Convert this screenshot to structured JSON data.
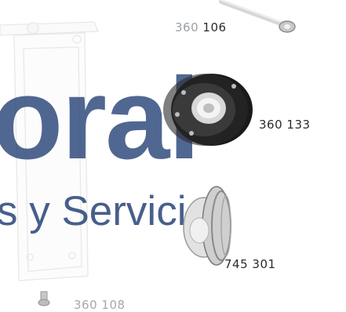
{
  "watermark": {
    "wordmark": "oral",
    "tagline": "s y Servicios"
  },
  "parts": [
    {
      "prefix": "360",
      "suffix": "106"
    },
    {
      "code": "360 133"
    },
    {
      "code": "745 301"
    },
    {
      "code": "360 108"
    }
  ],
  "colors": {
    "watermark_blue": "#1f3d73",
    "caption_dark": "#2b2b2b",
    "caption_faded": "#9aa0a6",
    "seal_black": "#1a1a1a"
  },
  "icons": [
    "shock-rod-image",
    "flange-bearing-image",
    "pulley-wheel-image",
    "support-bracket-image",
    "small-bolt-image"
  ]
}
